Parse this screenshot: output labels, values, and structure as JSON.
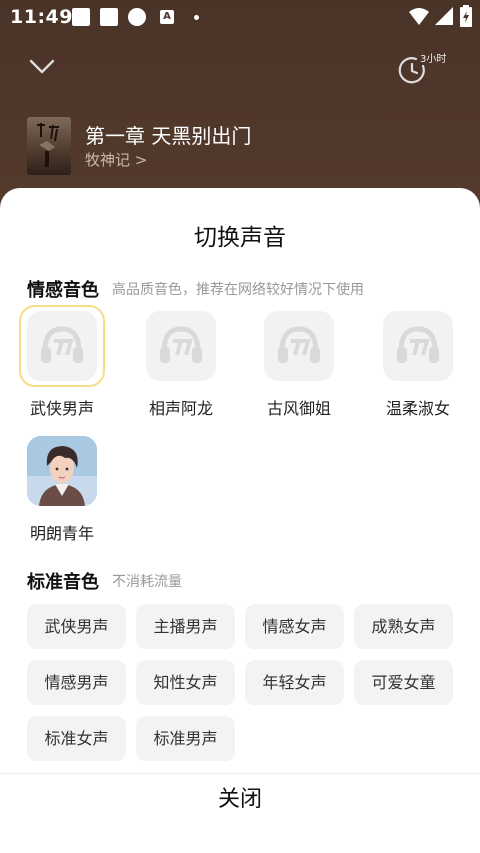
{
  "status": {
    "time": "11:49",
    "font_icon_letter": "A"
  },
  "player": {
    "timer_label": "3小时",
    "chapter_title": "第一章 天黑别出门",
    "author": "牧神记 >"
  },
  "sheet": {
    "title": "切换声音",
    "emotional": {
      "title": "情感音色",
      "subtitle": "高品质音色，推荐在网络较好情况下使用",
      "voices": [
        {
          "label": "武侠男声",
          "selected": true
        },
        {
          "label": "相声阿龙",
          "selected": false
        },
        {
          "label": "古风御姐",
          "selected": false
        },
        {
          "label": "温柔淑女",
          "selected": false
        },
        {
          "label": "明朗青年",
          "selected": false
        }
      ]
    },
    "standard": {
      "title": "标准音色",
      "subtitle": "不消耗流量",
      "chips": [
        "武侠男声",
        "主播男声",
        "情感女声",
        "成熟女声",
        "情感男声",
        "知性女声",
        "年轻女声",
        "可爱女童",
        "标准女声",
        "标准男声"
      ]
    },
    "close_label": "关闭"
  },
  "colors": {
    "sheet_bg": "#ffffff",
    "selected_ring": "#f7dc8a",
    "chip_bg": "#f3f3f3",
    "header_bg": "#4a3327"
  }
}
